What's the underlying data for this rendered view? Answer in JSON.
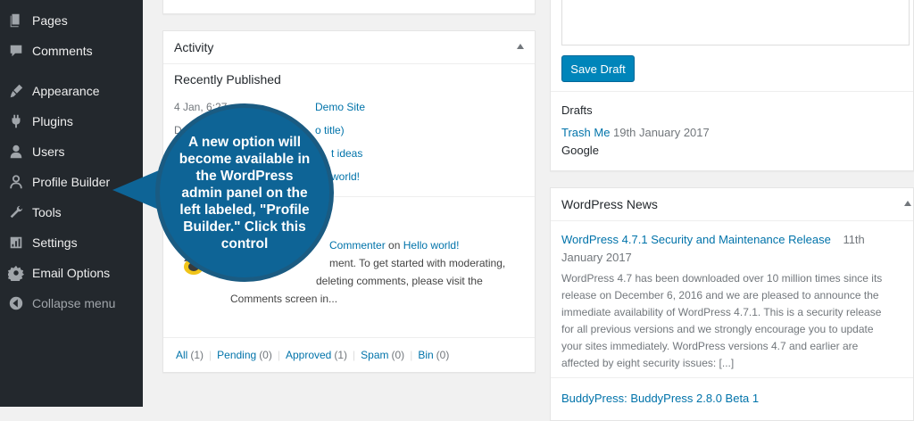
{
  "sidebar": {
    "items": [
      {
        "label": "Pages",
        "icon": "pages-icon"
      },
      {
        "label": "Comments",
        "icon": "comments-icon"
      },
      {
        "label": "Appearance",
        "icon": "appearance-icon"
      },
      {
        "label": "Plugins",
        "icon": "plugins-icon"
      },
      {
        "label": "Users",
        "icon": "users-icon"
      },
      {
        "label": "Profile Builder",
        "icon": "profile-builder-icon"
      },
      {
        "label": "Tools",
        "icon": "tools-icon"
      },
      {
        "label": "Settings",
        "icon": "settings-icon"
      },
      {
        "label": "Email Options",
        "icon": "email-options-icon"
      }
    ],
    "collapse_label": "Collapse menu"
  },
  "activity": {
    "title": "Activity",
    "recently_published": "Recently Published",
    "rows": [
      {
        "date": "4 Jan, 6:27",
        "title": "Demo Site"
      },
      {
        "date": "De",
        "title": "o title)"
      },
      {
        "date": "",
        "title": "t ideas"
      },
      {
        "date": "",
        "title": "world!"
      }
    ],
    "comment": {
      "author": "Commenter",
      "on_word": "on",
      "post": "Hello world!",
      "lines": [
        "ment. To get started with moderating,",
        "deleting comments, please visit the",
        "Comments screen in..."
      ]
    },
    "footer": [
      {
        "label": "All",
        "count": "(1)"
      },
      {
        "label": "Pending",
        "count": "(0)"
      },
      {
        "label": "Approved",
        "count": "(1)"
      },
      {
        "label": "Spam",
        "count": "(0)"
      },
      {
        "label": "Bin",
        "count": "(0)"
      }
    ]
  },
  "quick_draft": {
    "save_label": "Save Draft",
    "drafts_heading": "Drafts",
    "draft_title": "Trash Me",
    "draft_date": "19th January 2017",
    "draft_excerpt": "Google"
  },
  "news": {
    "title": "WordPress News",
    "item1_title": "WordPress 4.7.1 Security and Maintenance Release",
    "item1_date_a": "11th",
    "item1_date_b": "January 2017",
    "item1_lines": [
      "WordPress 4.7 has been downloaded over 10 million times since its",
      "release on December 6, 2016 and we are pleased to announce the",
      "immediate availability of WordPress 4.7.1. This is a security release",
      "for all previous versions and we strongly encourage you to update",
      "your sites immediately. WordPress versions 4.7 and earlier are",
      "affected by eight security issues: [...]"
    ],
    "item2_title": "BuddyPress: BuddyPress 2.8.0 Beta 1"
  },
  "callout": {
    "text": "A new option will become available in the WordPress admin panel on the left labeled, \"Profile Builder.\" Click this control"
  },
  "colors": {
    "sidebar_bg": "#23282d",
    "link": "#0073aa",
    "button": "#0085ba",
    "callout": "#0e6496"
  }
}
